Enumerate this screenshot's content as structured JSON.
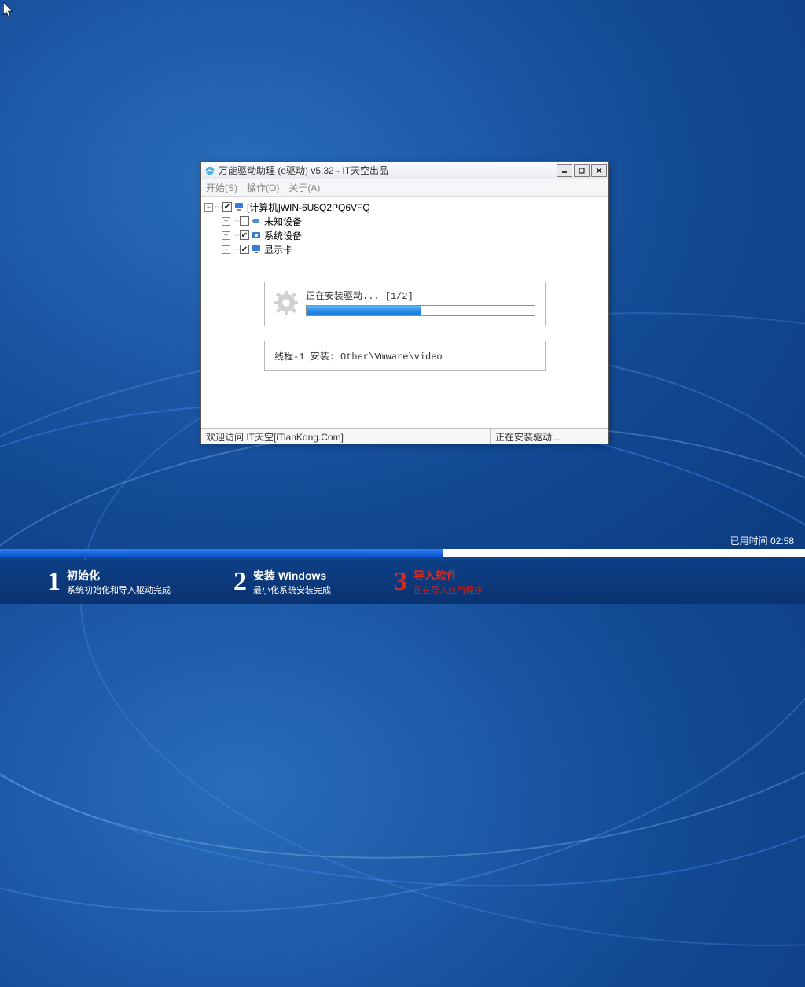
{
  "window": {
    "title": "万能驱动助理 (e驱动) v5.32 - IT天空出品",
    "menus": {
      "start": "开始(S)",
      "operate": "操作(O)",
      "about": "关于(A)"
    },
    "tree": {
      "root": "[计算机]WIN-6U8Q2PQ6VFQ",
      "items": [
        {
          "label": "未知设备",
          "checked": false
        },
        {
          "label": "系统设备",
          "checked": true
        },
        {
          "label": "显示卡",
          "checked": true
        }
      ]
    },
    "progress": {
      "label": "正在安装驱动... [1/2]",
      "percent": 50
    },
    "thread": "线程-1 安装:  Other\\Vmware\\video",
    "status": {
      "left": "欢迎访问 IT天空[iTianKong.Com]",
      "right": "正在安装驱动..."
    }
  },
  "installer": {
    "elapsed_label": "已用时间",
    "elapsed_time": "02:58",
    "progress_percent": 55,
    "steps": [
      {
        "num": "1",
        "title": "初始化",
        "sub": "系统初始化和导入驱动完成"
      },
      {
        "num": "2",
        "title": "安装 Windows",
        "sub": "最小化系统安装完成"
      },
      {
        "num": "3",
        "title": "导入软件",
        "sub": "正在导入应用程序"
      }
    ]
  }
}
